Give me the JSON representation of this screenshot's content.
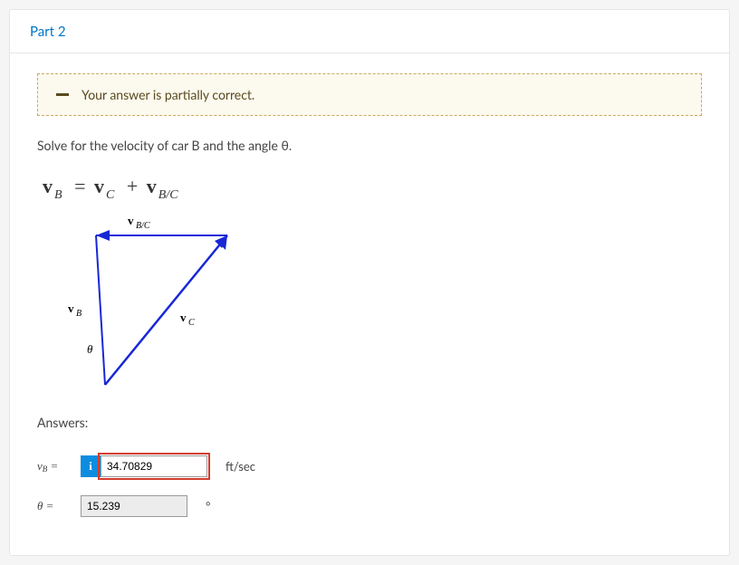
{
  "header": {
    "title": "Part 2"
  },
  "feedback": {
    "text": "Your answer is partially correct."
  },
  "prompt": "Solve for the velocity of car B and the angle θ.",
  "equation": {
    "lhs_sym": "v",
    "lhs_sub": "B",
    "eq": "=",
    "r1_sym": "v",
    "r1_sub": "C",
    "plus": "+",
    "r2_sym": "v",
    "r2_sub": "B/C"
  },
  "diagram": {
    "label_top": "B/C",
    "label_left_pre": "v",
    "label_left_sub": "B",
    "label_right_pre": "v",
    "label_right_sub": "C",
    "label_theta": "θ"
  },
  "answers": {
    "heading": "Answers:",
    "vb": {
      "label_main": "v",
      "label_sub": "B",
      "label_suffix": " =",
      "value": "34.70829",
      "unit": "ft/sec"
    },
    "theta": {
      "label": "θ =",
      "value": "15.239",
      "unit": "°"
    }
  }
}
